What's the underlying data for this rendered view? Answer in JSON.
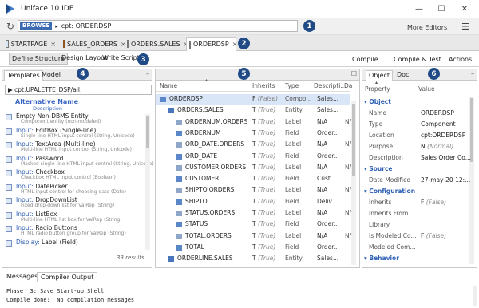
{
  "window": {
    "title": "Uniface 10 IDE",
    "controls": {
      "minimize": "—",
      "maximize": "☐",
      "close": "✕"
    }
  },
  "command": {
    "browse": "BROWSE",
    "arrow": "▸",
    "value": "cpt: ORDERDSP",
    "more_editors": "More Editors",
    "menu_icon": "☰"
  },
  "badges": [
    "1",
    "2",
    "3",
    "4",
    "5",
    "6"
  ],
  "editor_tabs": [
    {
      "label": "STARTPAGE",
      "close": "×"
    },
    {
      "label": "SALES_ORDERS",
      "close": "×"
    },
    {
      "label": "ORDERS.SALES",
      "close": "×"
    },
    {
      "label": "ORDERDSP",
      "close": "×"
    }
  ],
  "sub_tabs": [
    "Define Structure",
    "Design Layout",
    "Write Script"
  ],
  "actions": [
    "Compile",
    "Compile & Test",
    "Actions"
  ],
  "templates": {
    "tabs": [
      "Templates",
      "Model"
    ],
    "min": "–",
    "path": "▶  cpt:UPALETTE_DSP/all:",
    "header_name": "Alternative Name",
    "header_desc": "Description",
    "items": [
      {
        "kind": "",
        "name": "Empty Non-DBMS Entity",
        "desc": "Component entity (non-modeled)"
      },
      {
        "kind": "Input:",
        "name": " EditBox (Single-line)",
        "desc": "Single-line HTML input control (String, Unicode)"
      },
      {
        "kind": "Input:",
        "name": " TextArea (Multi-line)",
        "desc": "Multi-line HTML input control (String, Unicode)"
      },
      {
        "kind": "Input:",
        "name": " Password",
        "desc": "Masked single-line HTML input control (String, Unicode)"
      },
      {
        "kind": "Input:",
        "name": " Checkbox",
        "desc": "Checkbox HTML input control (Boolean)"
      },
      {
        "kind": "Input:",
        "name": " DatePicker",
        "desc": "HTML input control for choosing date (Date)"
      },
      {
        "kind": "Input:",
        "name": " DropDownList",
        "desc": "Fixed drop-down list for ValRep (String)"
      },
      {
        "kind": "Input:",
        "name": " ListBox",
        "desc": "Multi-line HTML list box for ValRep (String)"
      },
      {
        "kind": "Input:",
        "name": " Radio Buttons",
        "desc": "HTML radio button group for ValRep (String)"
      },
      {
        "kind": "Display:",
        "name": " Label (Field)",
        "desc": ""
      }
    ],
    "results": "33 results"
  },
  "structure": {
    "min": "☐",
    "columns": [
      "Name",
      "Inherits",
      "Type",
      "Descripti...",
      "Da"
    ],
    "sort_mark": "▴",
    "rows": [
      {
        "name": "ORDERDSP",
        "inherits": "F",
        "flag": "(False)",
        "type": "Compo...",
        "desc": "Sales...",
        "da": "",
        "level": 0,
        "sel": true
      },
      {
        "name": "ORDERS.SALES",
        "inherits": "T",
        "flag": "(True)",
        "type": "Entity",
        "desc": "Sales...",
        "da": "",
        "level": 1
      },
      {
        "name": "ORDERNUM.ORDERS",
        "inherits": "T",
        "flag": "(True)",
        "type": "Label",
        "desc": "N/A",
        "da": "N/",
        "level": 2
      },
      {
        "name": "ORDERNUM",
        "inherits": "T",
        "flag": "(True)",
        "type": "Field",
        "desc": "Order...",
        "da": "",
        "level": 2
      },
      {
        "name": "ORD_DATE.ORDERS",
        "inherits": "T",
        "flag": "(True)",
        "type": "Label",
        "desc": "N/A",
        "da": "N/",
        "level": 2
      },
      {
        "name": "ORD_DATE",
        "inherits": "T",
        "flag": "(True)",
        "type": "Field",
        "desc": "Order...",
        "da": "",
        "level": 2
      },
      {
        "name": "CUSTOMER.ORDERS",
        "inherits": "T",
        "flag": "(True)",
        "type": "Label",
        "desc": "N/A",
        "da": "N/",
        "level": 2
      },
      {
        "name": "CUSTOMER",
        "inherits": "T",
        "flag": "(True)",
        "type": "Field",
        "desc": "Cust...",
        "da": "",
        "level": 2
      },
      {
        "name": "SHIPTO.ORDERS",
        "inherits": "T",
        "flag": "(True)",
        "type": "Label",
        "desc": "N/A",
        "da": "N/",
        "level": 2
      },
      {
        "name": "SHIPTO",
        "inherits": "T",
        "flag": "(True)",
        "type": "Field",
        "desc": "Deliv...",
        "da": "",
        "level": 2
      },
      {
        "name": "STATUS.ORDERS",
        "inherits": "T",
        "flag": "(True)",
        "type": "Label",
        "desc": "N/A",
        "da": "N/",
        "level": 2
      },
      {
        "name": "STATUS",
        "inherits": "T",
        "flag": "(True)",
        "type": "Field",
        "desc": "Order...",
        "da": "",
        "level": 2
      },
      {
        "name": "TOTAL.ORDERS",
        "inherits": "T",
        "flag": "(True)",
        "type": "Label",
        "desc": "N/A",
        "da": "N/",
        "level": 2
      },
      {
        "name": "TOTAL",
        "inherits": "T",
        "flag": "(True)",
        "type": "Field",
        "desc": "Order...",
        "da": "",
        "level": 2
      },
      {
        "name": "ORDERLINE.SALES",
        "inherits": "T",
        "flag": "(True)",
        "type": "Entity",
        "desc": "Sales...",
        "da": "",
        "level": 1
      }
    ]
  },
  "properties": {
    "tabs": [
      "Object",
      "Doc"
    ],
    "min": "–",
    "columns": [
      "Property",
      "Value"
    ],
    "sort_mark": "▴",
    "sections": [
      {
        "title": "▾ Object",
        "props": [
          {
            "name": "Name",
            "value": "ORDERDSP"
          },
          {
            "name": "Type",
            "value": "Component"
          },
          {
            "name": "Location",
            "value": "cpt:ORDERDSP"
          },
          {
            "name": "Purpose",
            "value": "N",
            "flag": "(Normal)"
          },
          {
            "name": "Description",
            "value": "Sales Order Co..."
          }
        ]
      },
      {
        "title": "▾ Source",
        "props": [
          {
            "name": "Date Modified",
            "value": "27-may-20 12:..."
          }
        ]
      },
      {
        "title": "▾ Configuration",
        "props": [
          {
            "name": "Inherits",
            "value": "F",
            "flag": "(False)"
          },
          {
            "name": "Inherits From",
            "value": ""
          },
          {
            "name": "Library",
            "value": ""
          },
          {
            "name": "Is Modeled Co...",
            "value": "F",
            "flag": "(False)"
          },
          {
            "name": "Modeled Com...",
            "value": ""
          }
        ]
      },
      {
        "title": "▾ Behavior",
        "props": []
      }
    ]
  },
  "bottom": {
    "tabs": [
      "Messages",
      "Compiler Output"
    ],
    "lines": [
      "Phase  3: Save Start-up Shell",
      "Compile done:  No compilation messages"
    ]
  }
}
